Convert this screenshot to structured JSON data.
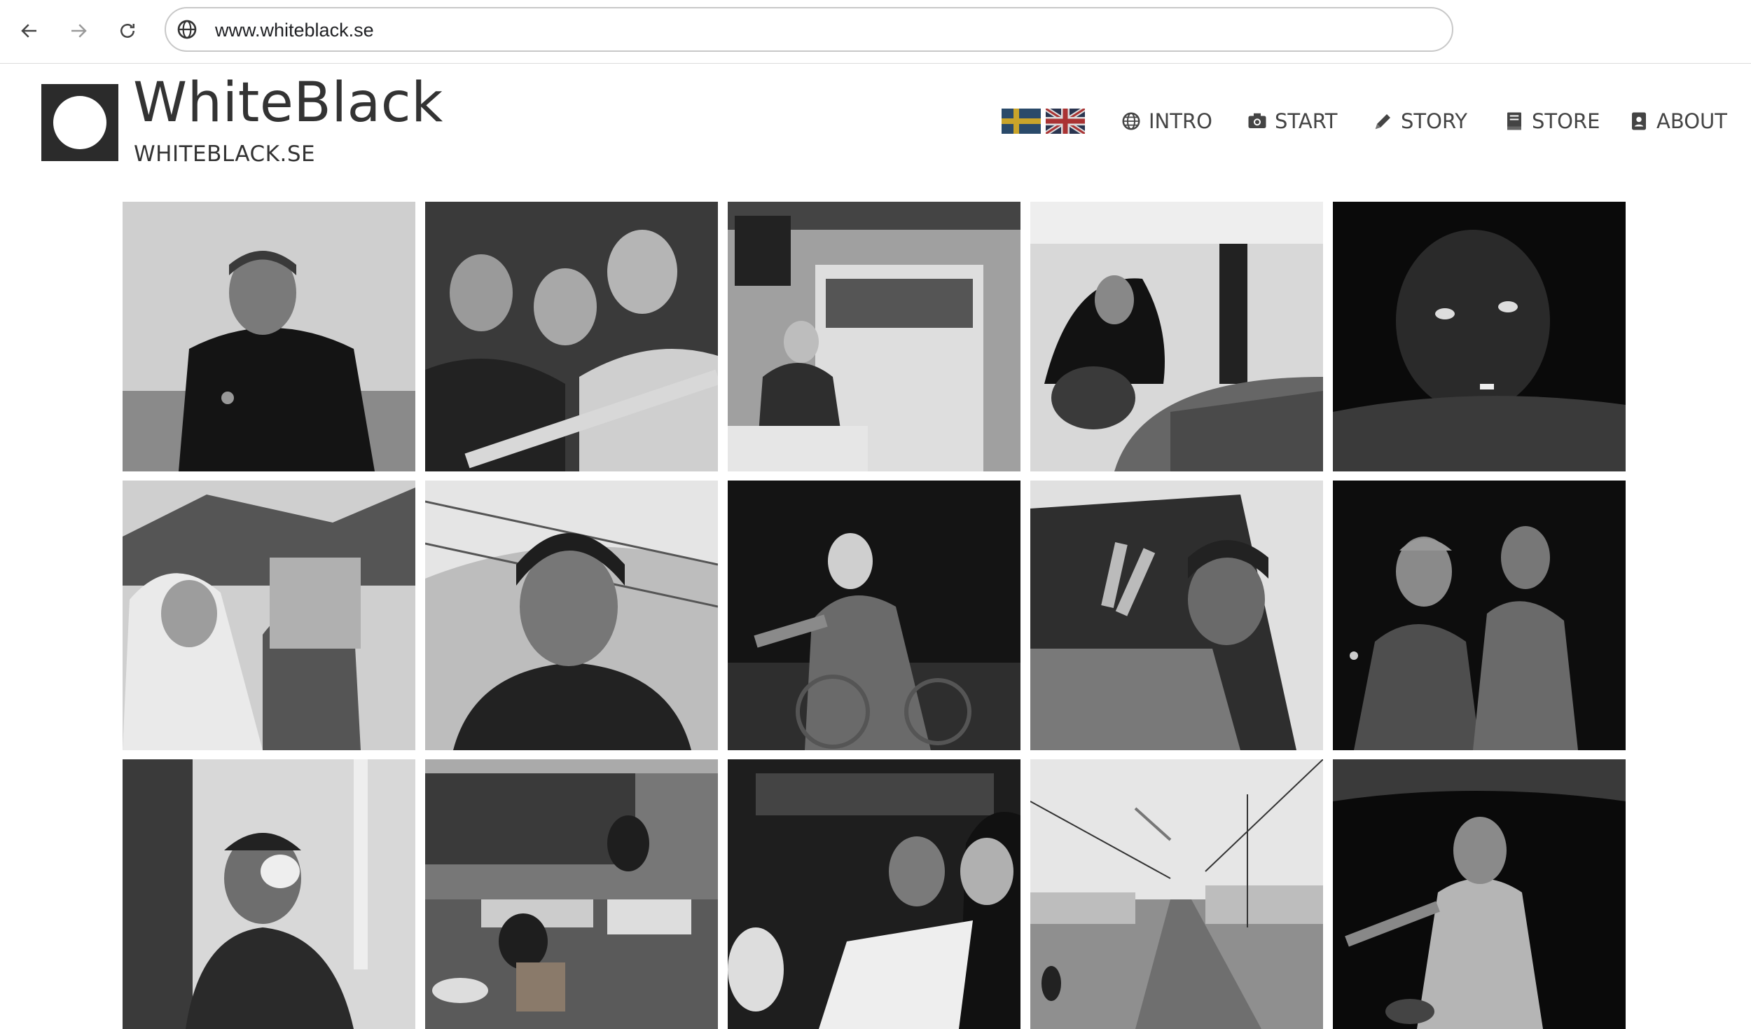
{
  "browser": {
    "url": "www.whiteblack.se",
    "icons": [
      "back-arrow-icon",
      "forward-arrow-icon",
      "reload-icon",
      "globe-icon"
    ]
  },
  "site": {
    "brand_name": "WhiteBlack",
    "brand_sub": "WHITEBLACK.SE"
  },
  "flags": [
    "swedish-flag",
    "uk-flag"
  ],
  "menu": [
    {
      "label": "INTRO",
      "icon": "globe-icon"
    },
    {
      "label": "START",
      "icon": "camera-icon"
    },
    {
      "label": "STORY",
      "icon": "pencil-icon"
    },
    {
      "label": "STORE",
      "icon": "book-icon"
    },
    {
      "label": "ABOUT",
      "icon": "id-badge-icon"
    }
  ],
  "colors": {
    "logo_dark": "#2b2b2b",
    "text": "#333333",
    "menu_text": "#444444"
  },
  "photos": [
    "man-in-coat-with-stethoscope",
    "children-at-barrier",
    "elderly-woman-in-kitchen",
    "woman-with-oxygen-tank",
    "boy-resting-head-on-arms",
    "mother-holding-baby",
    "man-in-beanie-by-fence",
    "elderly-woman-in-wheelchair",
    "man-in-car-window-peace-sign",
    "men-in-crowd-at-night",
    "boy-with-eye-bandage",
    "people-working-by-wooden-house",
    "family-in-bus",
    "camp-road-with-kite",
    "man-in-dark-room"
  ]
}
